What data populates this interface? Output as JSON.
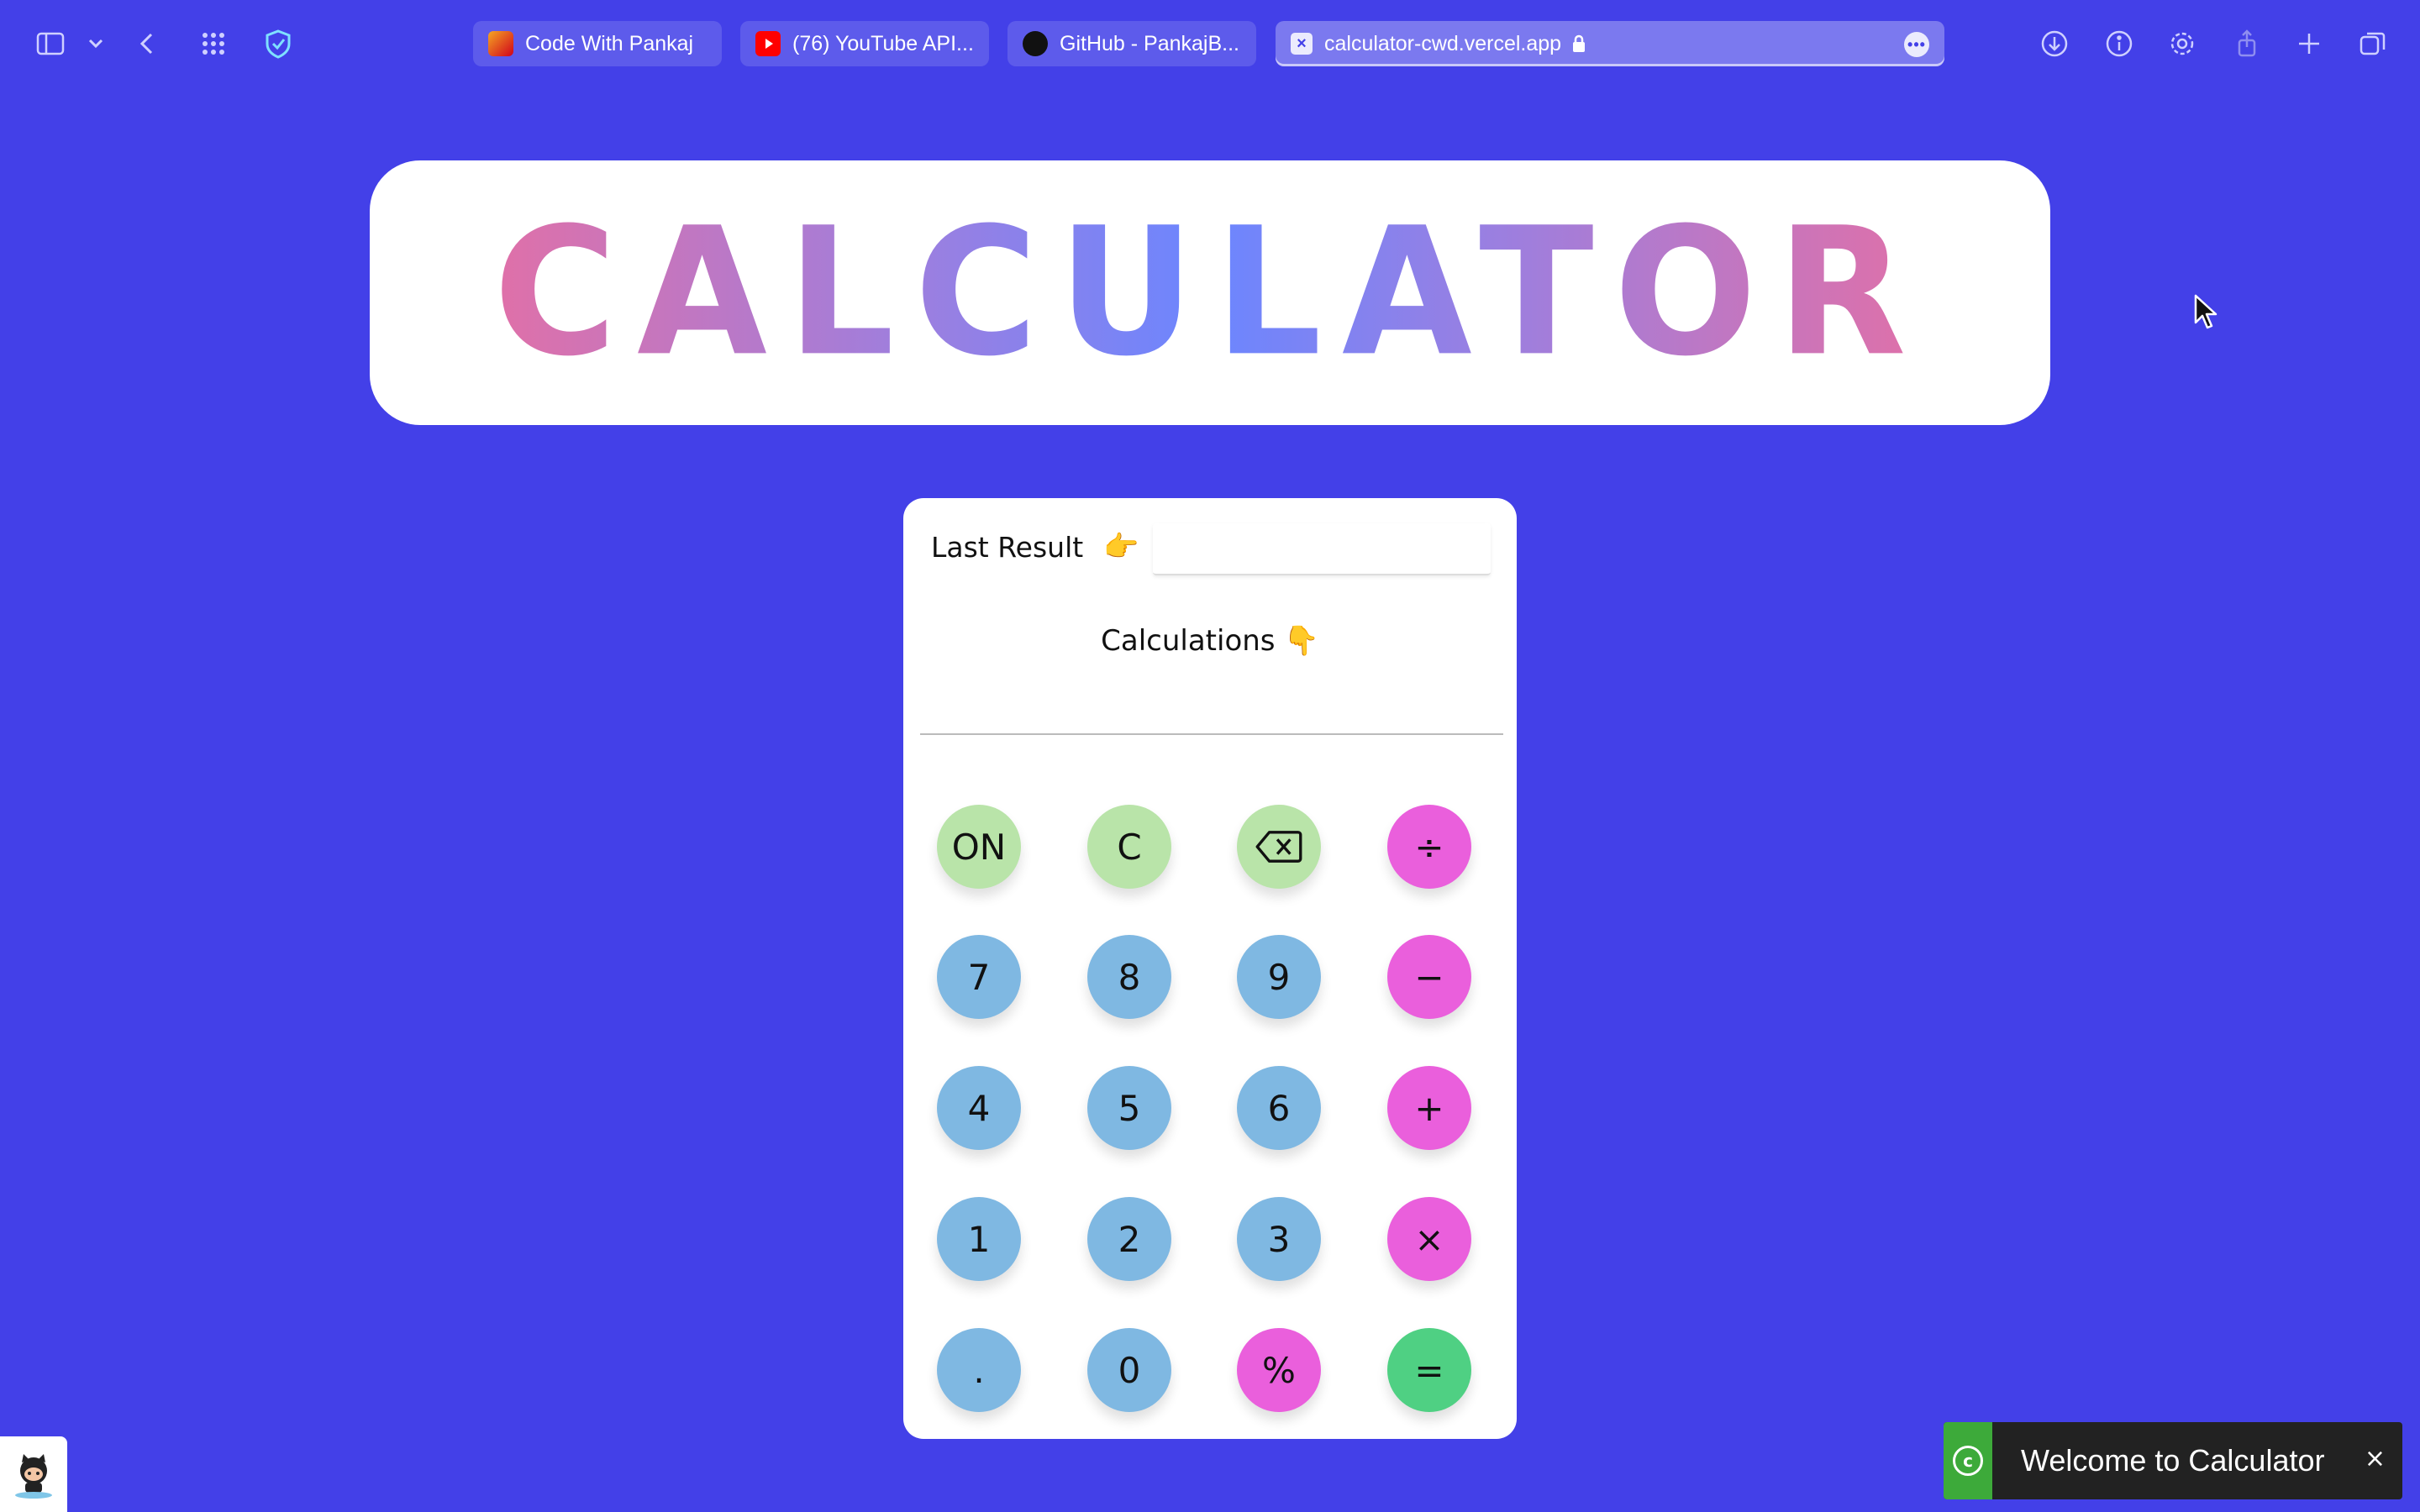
{
  "browser": {
    "tabs": [
      {
        "title": "Code With Pankaj",
        "favicon": "cwp-favicon"
      },
      {
        "title": "(76) YouTube API...",
        "favicon": "youtube-icon"
      },
      {
        "title": "GitHub - PankajB...",
        "favicon": "github-icon"
      },
      {
        "title": "calculator-cwd.vercel.app",
        "favicon": "close-tab-icon",
        "active": true
      }
    ]
  },
  "header": {
    "title": "CALCULATOR"
  },
  "calculator": {
    "last_result_label": "Last Result",
    "last_result_emoji": "👉",
    "last_result_value": "",
    "calculations_label": "Calculations",
    "calculations_emoji": "👇",
    "display_value": "",
    "keys": [
      [
        "ON",
        "C",
        "⌫",
        "÷"
      ],
      [
        "7",
        "8",
        "9",
        "−"
      ],
      [
        "4",
        "5",
        "6",
        "+"
      ],
      [
        "1",
        "2",
        "3",
        "×"
      ],
      [
        ".",
        "0",
        "%",
        "="
      ]
    ]
  },
  "toast": {
    "message": "Welcome to Calculator",
    "close": "×",
    "icon": "c"
  },
  "colors": {
    "background": "#4340e8",
    "key_control": "#b9e4a9",
    "key_number": "#7fb8e2",
    "key_operator": "#ea5fdc",
    "key_equals": "#4fd083"
  }
}
